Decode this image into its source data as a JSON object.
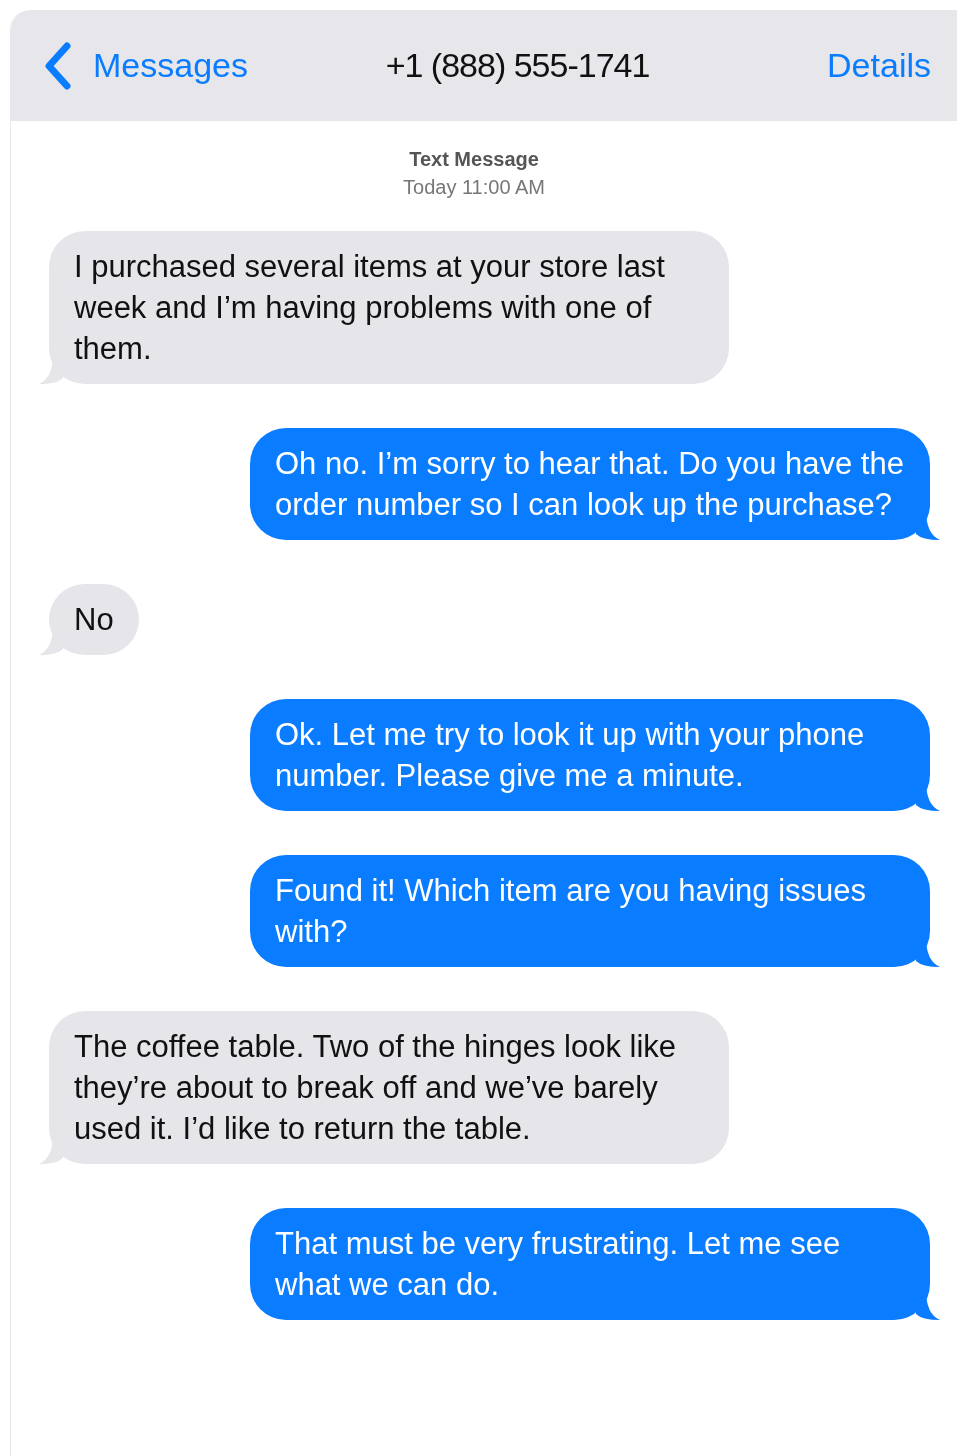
{
  "header": {
    "back_label": "Messages",
    "title": "+1 (888) 555-1741",
    "details": "Details"
  },
  "meta": {
    "label": "Text Message",
    "time": "Today 11:00 AM"
  },
  "messages": [
    {
      "kind": "incoming",
      "text": "I purchased several items at your store last week and I’m having problems with one of them."
    },
    {
      "kind": "outgoing",
      "text": "Oh no. I’m sorry to hear that. Do you have the order number so I can look up the purchase?"
    },
    {
      "kind": "incoming",
      "text": "No"
    },
    {
      "kind": "outgoing",
      "text": "Ok. Let me try to look it up with your phone number. Please give me a minute."
    },
    {
      "kind": "outgoing",
      "text": "Found it! Which item are you having issues with?"
    },
    {
      "kind": "incoming",
      "text": "The coffee table. Two of the hinges look like they’re about to break off and we’ve barely used it. I’d like to return the table."
    },
    {
      "kind": "outgoing",
      "text": "That must be very frustrating. Let me see what we can do."
    }
  ]
}
